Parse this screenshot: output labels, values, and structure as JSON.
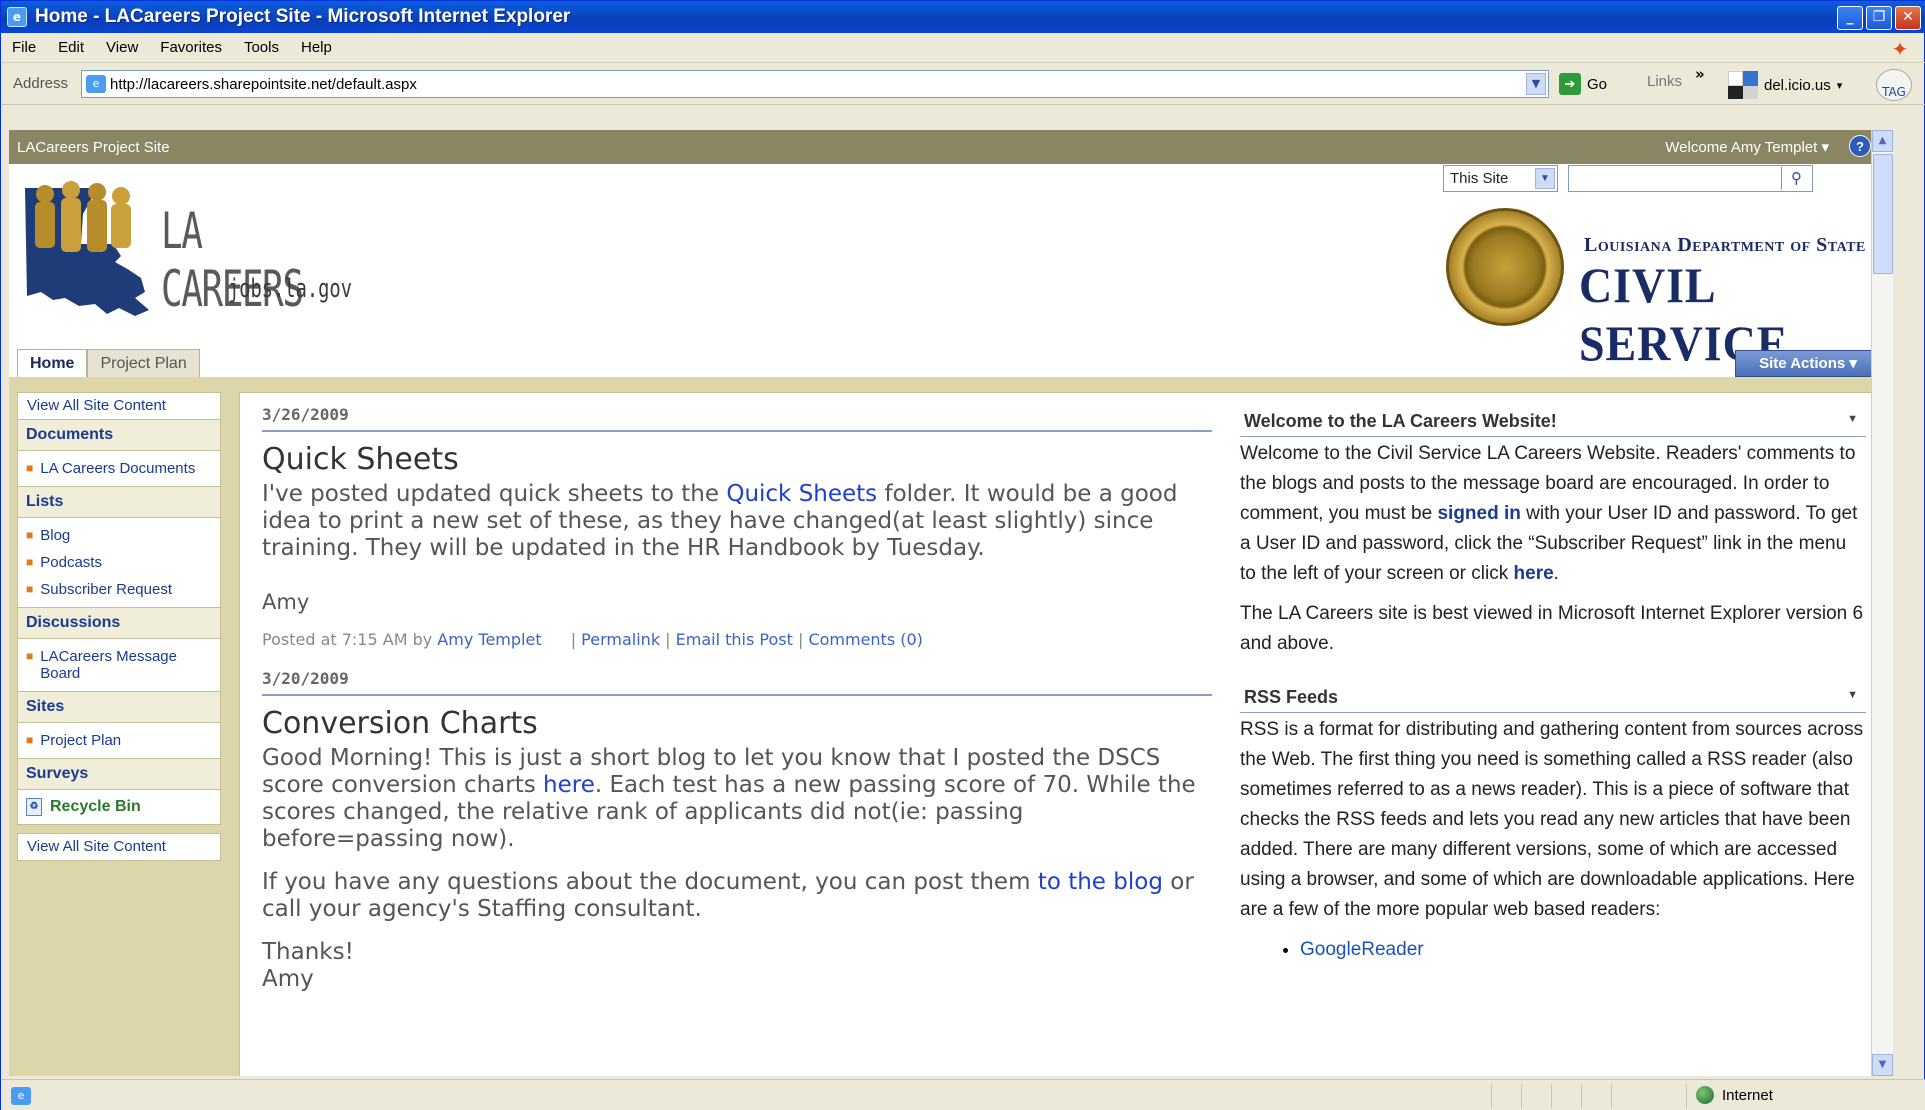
{
  "window": {
    "title": "Home - LACareers Project Site - Microsoft Internet Explorer"
  },
  "menu": [
    "File",
    "Edit",
    "View",
    "Favorites",
    "Tools",
    "Help"
  ],
  "address": {
    "label": "Address",
    "url": "http://lacareers.sharepointsite.net/default.aspx",
    "go": "Go",
    "links": "Links",
    "delicious": "del.icio.us",
    "tag": "TAG"
  },
  "site": {
    "top_title": "LACareers Project Site",
    "welcome": "Welcome Amy Templet ▾",
    "logo_title": "LA CAREERS",
    "logo_sub": "jobs.la.gov",
    "search_scope": "This Site",
    "search_value": "",
    "dept_top": "Louisiana Department of State",
    "dept_main": "CIVIL SERVICE",
    "tabs": [
      {
        "label": "Home"
      },
      {
        "label": "Project Plan"
      }
    ],
    "site_actions": "Site Actions ▾"
  },
  "quicklaunch": {
    "view_all": "View All Site Content",
    "sections": [
      {
        "heading": "Documents",
        "items": [
          "LA Careers Documents"
        ]
      },
      {
        "heading": "Lists",
        "items": [
          "Blog",
          "Podcasts",
          "Subscriber Request"
        ]
      },
      {
        "heading": "Discussions",
        "items": [
          "LACareers Message Board"
        ]
      },
      {
        "heading": "Sites",
        "items": [
          "Project Plan"
        ]
      },
      {
        "heading": "Surveys",
        "items": []
      }
    ],
    "recycle": "Recycle Bin",
    "view_all_bottom": "View All Site Content"
  },
  "posts": [
    {
      "date": "3/26/2009",
      "title": "Quick Sheets",
      "p1a": "I've posted updated quick sheets to the ",
      "p1link": "Quick Sheets",
      "p1b": " folder. It would be a good idea to print a new set of these, as they have changed(at least slightly) since training. They will be updated in the HR Handbook by Tuesday.",
      "author": "Amy",
      "posted_prefix": "Posted at 7:15 AM by ",
      "posted_by": "Amy Templet",
      "permalink": "Permalink",
      "email": "Email this Post",
      "comments": "Comments (0)"
    },
    {
      "date": "3/20/2009",
      "title": "Conversion Charts",
      "p1a": "Good Morning! This is just a short blog to let you know that I posted the DSCS score conversion charts ",
      "p1link": "here",
      "p1b": ". Each test has a new passing score of 70. While the scores changed, the relative rank of applicants did not(ie: passing before=passing now).",
      "p2a": "If you have any questions about the document, you can post them ",
      "p2link": "to the blog",
      "p2b": " or call your agency's Staffing consultant.",
      "thanks": "Thanks!",
      "author": "Amy"
    }
  ],
  "right": {
    "welcome_title": "Welcome to the LA Careers Website!",
    "welcome_p1a": "Welcome to the Civil Service LA Careers Website. Readers' comments to the blogs and posts to the message board are encouraged. In order to comment, you must be ",
    "welcome_link1": "signed in",
    "welcome_p1b": " with your User ID and password. To get a User ID and password, click the “Subscriber Request” link in the menu to the left of your screen or click ",
    "welcome_link2": "here",
    "welcome_p1c": ".",
    "welcome_p2": "The LA Careers site is best viewed in Microsoft Internet Explorer version 6 and above.",
    "rss_title": "RSS Feeds",
    "rss_text": "RSS is a format for distributing and gathering content from sources across the Web. The first thing you need is something called a RSS reader (also sometimes referred to as a news reader).  This is a piece of software that checks the RSS feeds and lets you read any new articles that have been added. There are many different versions, some of which are accessed using a browser, and some of which are downloadable applications. Here are a few of the more popular web based readers:",
    "rss_items": [
      "GoogleReader"
    ]
  },
  "status": {
    "zone": "Internet"
  }
}
